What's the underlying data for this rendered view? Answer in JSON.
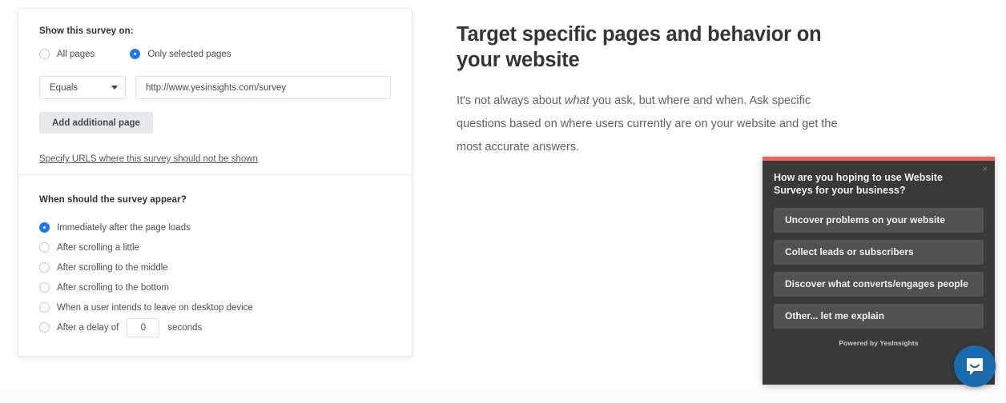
{
  "settings_card": {
    "show_section": {
      "label": "Show this survey on:",
      "options": [
        {
          "label": "All pages",
          "selected": false
        },
        {
          "label": "Only selected pages",
          "selected": true
        }
      ],
      "match_select": {
        "value": "Equals",
        "caret": "chevron-down-icon"
      },
      "url_value": "http://www.yesinsights.com/survey",
      "add_page_button": "Add additional page",
      "exclude_link": "Specify URLS where this survey should not be shown"
    },
    "timing_section": {
      "label": "When should the survey appear?",
      "options": [
        {
          "label": "Immediately after the page loads",
          "selected": true
        },
        {
          "label": "After scrolling a little",
          "selected": false
        },
        {
          "label": "After scrolling to the middle",
          "selected": false
        },
        {
          "label": "After scrolling to the bottom",
          "selected": false
        },
        {
          "label": "When a user intends to leave on desktop device",
          "selected": false
        }
      ],
      "delay_option": {
        "prefix": "After a delay of",
        "value": "0",
        "suffix": "seconds",
        "selected": false
      }
    }
  },
  "marketing": {
    "heading": "Target specific pages and behavior on your website",
    "body_part1": "It's not always about ",
    "body_emphasis": "what",
    "body_part2": " you ask, but where and when. Ask specific questions based on where users currently are on your website and get the most accurate answers."
  },
  "survey_widget": {
    "close_label": "×",
    "question": "How are you hoping to use Website Surveys for your business?",
    "options": [
      "Uncover problems on your website",
      "Collect leads or subscribers",
      "Discover what converts/engages people",
      "Other... let me explain"
    ],
    "footer": "Powered by YesInsights",
    "accent_color": "#f4625e",
    "background_color": "#3a3a3a",
    "option_color": "#515151"
  },
  "chat_launcher": {
    "icon": "chat-bubble-icon",
    "color": "#1a6bad"
  },
  "colors": {
    "radio_accent": "#2176e8",
    "page_background": "#ffffff"
  }
}
